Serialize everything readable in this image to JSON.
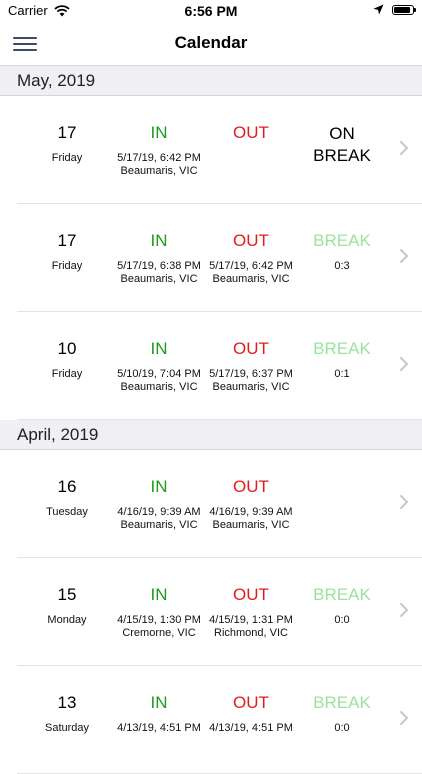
{
  "status_bar": {
    "carrier": "Carrier",
    "time": "6:56 PM",
    "battery_level": 0.9
  },
  "nav": {
    "title": "Calendar"
  },
  "sections": [
    {
      "title": "May, 2019",
      "rows": [
        {
          "day": "17",
          "weekday": "Friday",
          "in_label": "IN",
          "in_time": "5/17/19, 6:42 PM",
          "in_place": "Beaumaris, VIC",
          "out_label": "OUT",
          "out_time": "",
          "out_place": "",
          "break_label": "ON BREAK",
          "break_value": ""
        },
        {
          "day": "17",
          "weekday": "Friday",
          "in_label": "IN",
          "in_time": "5/17/19, 6:38 PM",
          "in_place": "Beaumaris, VIC",
          "out_label": "OUT",
          "out_time": "5/17/19, 6:42 PM",
          "out_place": "Beaumaris, VIC",
          "break_label": "BREAK",
          "break_value": "0:3"
        },
        {
          "day": "10",
          "weekday": "Friday",
          "in_label": "IN",
          "in_time": "5/10/19, 7:04 PM",
          "in_place": "Beaumaris, VIC",
          "out_label": "OUT",
          "out_time": "5/17/19, 6:37 PM",
          "out_place": "Beaumaris, VIC",
          "break_label": "BREAK",
          "break_value": "0:1"
        }
      ]
    },
    {
      "title": "April, 2019",
      "rows": [
        {
          "day": "16",
          "weekday": "Tuesday",
          "in_label": "IN",
          "in_time": "4/16/19, 9:39 AM",
          "in_place": "Beaumaris, VIC",
          "out_label": "OUT",
          "out_time": "4/16/19, 9:39 AM",
          "out_place": "Beaumaris, VIC",
          "break_label": "",
          "break_value": ""
        },
        {
          "day": "15",
          "weekday": "Monday",
          "in_label": "IN",
          "in_time": "4/15/19, 1:30 PM",
          "in_place": "Cremorne, VIC",
          "out_label": "OUT",
          "out_time": "4/15/19, 1:31 PM",
          "out_place": "Richmond, VIC",
          "break_label": "BREAK",
          "break_value": "0:0"
        },
        {
          "day": "13",
          "weekday": "Saturday",
          "in_label": "IN",
          "in_time": "4/13/19, 4:51 PM",
          "in_place": "",
          "out_label": "OUT",
          "out_time": "4/13/19, 4:51 PM",
          "out_place": "",
          "break_label": "BREAK",
          "break_value": "0:0"
        }
      ]
    }
  ]
}
